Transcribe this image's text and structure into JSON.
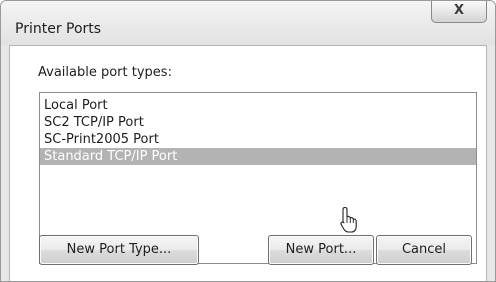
{
  "window": {
    "title": "Printer Ports",
    "close_label": "X"
  },
  "group": {
    "label": "Available port types:"
  },
  "ports": [
    {
      "label": "Local Port",
      "selected": false
    },
    {
      "label": "SC2 TCP/IP Port",
      "selected": false
    },
    {
      "label": "SC-Print2005 Port",
      "selected": false
    },
    {
      "label": "Standard TCP/IP Port",
      "selected": true
    }
  ],
  "buttons": {
    "new_port_type": "New Port Type...",
    "new_port": "New Port...",
    "cancel": "Cancel"
  },
  "icons": {
    "close": "close-icon",
    "cursor": "hand-pointer-icon"
  },
  "colors": {
    "selection": "#b3b3b3",
    "window_frame": "#e8e8e8"
  }
}
